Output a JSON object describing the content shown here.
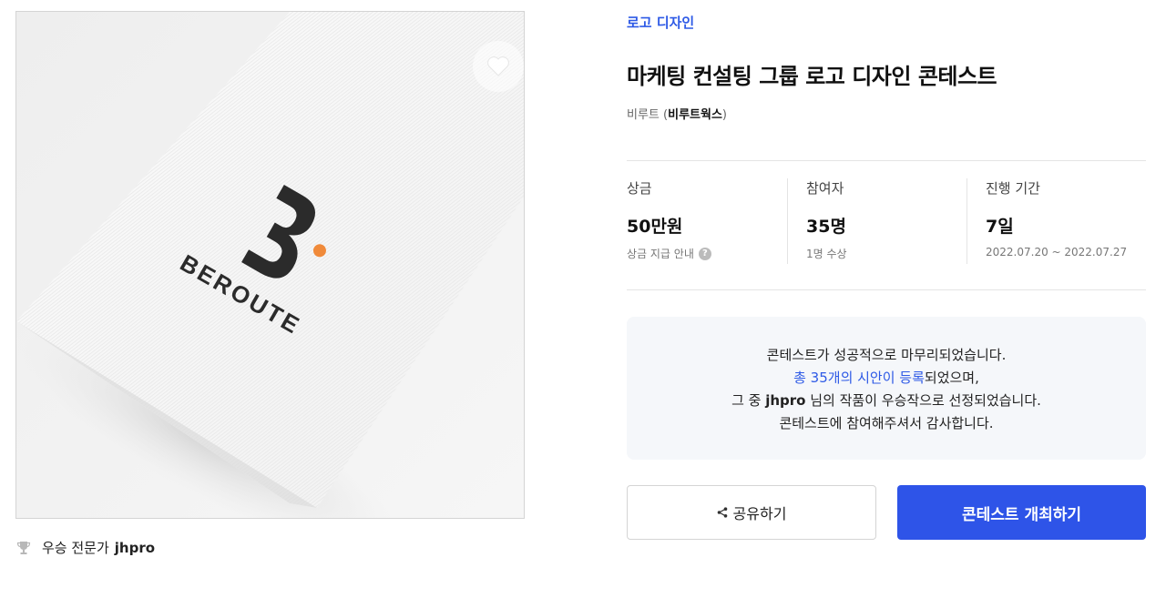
{
  "image": {
    "logo_text": "BEROUTE",
    "accent_color": "#f08a3a"
  },
  "winner": {
    "label": "우승 전문가",
    "name": "jhpro"
  },
  "contest": {
    "category": "로고 디자인",
    "title": "마케팅 컨설팅 그룹 로고 디자인 콘테스트",
    "client_name": "비루트",
    "client_company": "비루트웍스"
  },
  "stats": [
    {
      "label": "상금",
      "value": "50만원",
      "sub": "상금 지급 안내"
    },
    {
      "label": "참여자",
      "value": "35명",
      "sub": "1명 수상"
    },
    {
      "label": "진행 기간",
      "value": "7일",
      "sub": "2022.07.20 ~ 2022.07.27"
    }
  ],
  "notice": {
    "line1": "콘테스트가 성공적으로 마무리되었습니다.",
    "line2_highlight": "총 35개의 시안이 등록",
    "line2_rest": "되었으며,",
    "line3_pre": "그 중 ",
    "line3_name": "jhpro",
    "line3_post": " 님의 작품이 우승작으로 선정되었습니다.",
    "line4": "콘테스트에 참여해주셔서 감사합니다."
  },
  "buttons": {
    "share": "공유하기",
    "host": "콘테스트 개최하기"
  },
  "colors": {
    "brand_blue": "#2e54e8",
    "link_blue": "#2e5ae6"
  }
}
